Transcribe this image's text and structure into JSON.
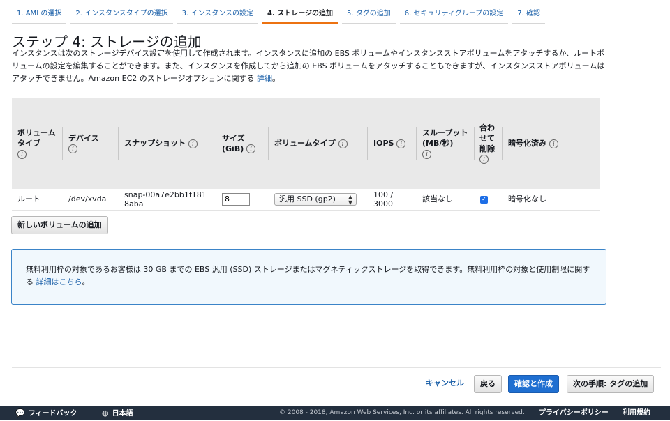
{
  "tabs": [
    {
      "label": "1. AMI の選択",
      "active": false
    },
    {
      "label": "2. インスタンスタイプの選択",
      "active": false
    },
    {
      "label": "3. インスタンスの設定",
      "active": false
    },
    {
      "label": "4. ストレージの追加",
      "active": true
    },
    {
      "label": "5. タグの追加",
      "active": false
    },
    {
      "label": "6. セキュリティグループの設定",
      "active": false
    },
    {
      "label": "7. 確認",
      "active": false
    }
  ],
  "page": {
    "title": "ステップ 4: ストレージの追加",
    "intro_text": "インスタンスは次のストレージデバイス設定を使用して作成されます。インスタンスに追加の EBS ボリュームやインスタンスストアボリュームをアタッチするか、ルートボリュームの設定を編集することができます。また、インスタンスを作成してから追加の EBS ボリュームをアタッチすることもできますが、インスタンスストアボリュームはアタッチできません。Amazon EC2 のストレージオプションに関する ",
    "intro_link": "詳細",
    "intro_end": "。"
  },
  "table": {
    "headers": {
      "volume_type": "ボリュームタイプ",
      "device": "デバイス",
      "snapshot": "スナップショット",
      "size": "サイズ (GiB)",
      "ebs_volume_type": "ボリュームタイプ",
      "iops": "IOPS",
      "throughput": "スループット (MB/秒)",
      "delete_on_termination": "合わせて削除",
      "encrypted": "暗号化済み"
    },
    "info_glyph": "i",
    "rows": [
      {
        "volume_type": "ルート",
        "device": "/dev/xvda",
        "snapshot": "snap-00a7e2bb1f1818aba",
        "size": "8",
        "ebs_volume_type": "汎用 SSD (gp2)",
        "iops": "100 / 3000",
        "throughput": "該当なし",
        "delete_on_termination": true,
        "encrypted": "暗号化なし"
      }
    ]
  },
  "buttons": {
    "add_volume": "新しいボリュームの追加",
    "cancel": "キャンセル",
    "back": "戻る",
    "review_launch": "確認と作成",
    "next": "次の手順: タグの追加"
  },
  "info_box": {
    "text": "無料利用枠の対象であるお客様は 30 GB までの EBS 汎用 (SSD) ストレージまたはマグネティックストレージを取得できます。無料利用枠の対象と使用制限に関する ",
    "link": "詳細はこちら",
    "end": "。"
  },
  "footer": {
    "feedback": "フィードバック",
    "language": "日本語",
    "copyright": "© 2008 - 2018, Amazon Web Services, Inc. or its affiliates. All rights reserved.",
    "privacy": "プライバシーポリシー",
    "terms": "利用規約"
  },
  "colors": {
    "accent_tab": "#ec7211",
    "primary_button": "#1f6fd1",
    "link": "#1a5fa8",
    "footer_bg": "#232f3e",
    "info_border": "#3b84c8"
  }
}
